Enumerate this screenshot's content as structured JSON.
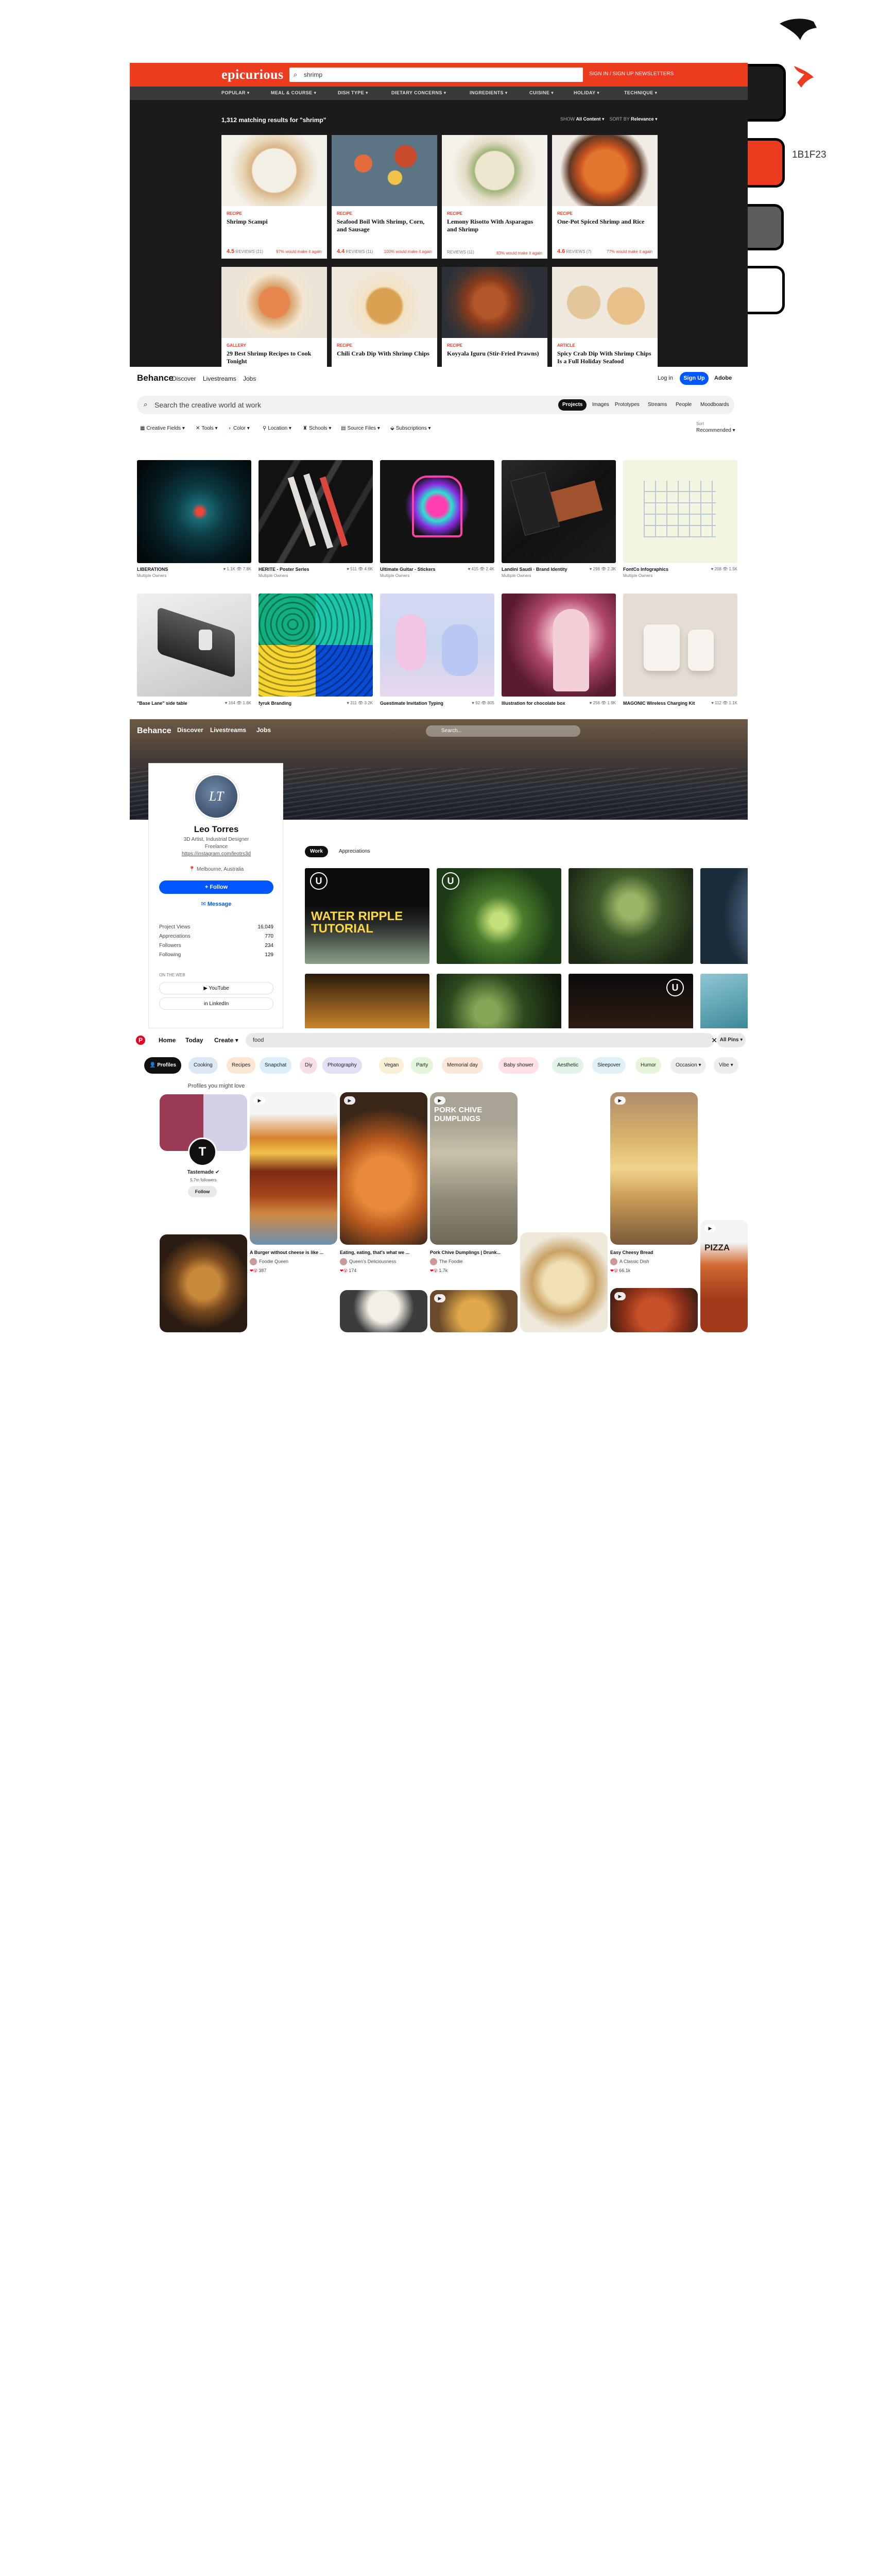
{
  "palette": {
    "swatches": [
      {
        "color": "#1b1b1b"
      },
      {
        "color": "#ec3b1f"
      },
      {
        "color": "#5c5c5c"
      },
      {
        "color": "#ffffff"
      }
    ],
    "code_label": "1B1F23"
  },
  "epicurious": {
    "logo": "epicurious",
    "search_value": "shrimp",
    "account_links": "SIGN IN / SIGN UP    NEWSLETTERS",
    "nav": [
      "POPULAR ▾",
      "MEAL & COURSE ▾",
      "DISH TYPE ▾",
      "DIETARY CONCERNS ▾",
      "INGREDIENTS ▾",
      "CUISINE ▾",
      "HOLIDAY ▾",
      "TECHNIQUE ▾"
    ],
    "result_count": "1,312 matching results for \"shrimp\"",
    "show_label": "SHOW",
    "show_value": "All Content ▾",
    "sort_label": "SORT BY",
    "sort_value": "Relevance ▾",
    "cards": [
      {
        "tag": "RECIPE",
        "title": "Shrimp Scampi",
        "rating": "4.5",
        "reviews": "97% would make it again",
        "count": "REVIEWS (21)"
      },
      {
        "tag": "RECIPE",
        "title": "Seafood Boil With Shrimp, Corn, and Sausage",
        "rating": "4.4",
        "reviews": "REVIEWS (11)",
        "count": "100% would make it again"
      },
      {
        "tag": "RECIPE",
        "title": "Lemony Risotto With Asparagus and Shrimp",
        "rating": "",
        "reviews": "REVIEWS (11)",
        "count": "83% would make it again"
      },
      {
        "tag": "RECIPE",
        "title": "One-Pot Spiced Shrimp and Rice",
        "rating": "4.6",
        "reviews": "REVIEWS (7)",
        "count": "77% would make it again"
      },
      {
        "tag": "GALLERY",
        "title": "29 Best Shrimp Recipes to Cook Tonight",
        "rating": "",
        "reviews": "",
        "count": ""
      },
      {
        "tag": "RECIPE",
        "title": "Chili Crab Dip With Shrimp Chips",
        "rating": "",
        "reviews": "",
        "count": ""
      },
      {
        "tag": "RECIPE",
        "title": "Koyyala Iguru (Stir-Fried Prawns)",
        "rating": "",
        "reviews": "",
        "count": ""
      },
      {
        "tag": "ARTICLE",
        "title": "Spicy Crab Dip With Shrimp Chips Is a Full Holiday Seafood",
        "rating": "",
        "reviews": "",
        "count": ""
      }
    ]
  },
  "behance": {
    "brand": "Behance",
    "nav": [
      "Discover",
      "Livestreams",
      "Jobs"
    ],
    "login": "Log in",
    "signup": "Sign Up",
    "adobe": "Adobe",
    "search_placeholder": "Search the creative world at work",
    "segments": [
      "Projects",
      "Images",
      "Prototypes",
      "Streams",
      "People",
      "Moodboards"
    ],
    "filters": [
      "Creative Fields ▾",
      "Tools ▾",
      "Color ▾",
      "Location ▾",
      "Schools ▾",
      "Source Files ▾",
      "Subscriptions ▾"
    ],
    "sort_label": "Sort",
    "sort_value": "Recommended ▾",
    "tiles": [
      {
        "title": "LIBERATIONS",
        "owner": "Multiple Owners",
        "stats": "♥ 1.1K  👁 7.8K"
      },
      {
        "title": "HERITE - Poster Series",
        "owner": "Multiple Owners",
        "stats": "♥ 511  👁 4.6K"
      },
      {
        "title": "Ultimate Guitar - Stickers",
        "owner": "Multiple Owners",
        "stats": "♥ 415  👁 2.4K"
      },
      {
        "title": "Landini Saudi · Brand Identity",
        "owner": "Multiple Owners",
        "stats": "♥ 298  👁 2.3K"
      },
      {
        "title": "FontCo Infographics",
        "owner": "Multiple Owners",
        "stats": "♥ 208  👁 1.5K"
      },
      {
        "title": "\"Base Lane\" side table",
        "owner": "",
        "stats": "♥ 164  👁 1.6K"
      },
      {
        "title": "fyruk Branding",
        "owner": "",
        "stats": "♥ 311  👁 3.2K"
      },
      {
        "title": "Guestimate Invitation Typing",
        "owner": "",
        "stats": "♥ 92  👁 805"
      },
      {
        "title": "Illustration for chocolate box",
        "owner": "",
        "stats": "♥ 256  👁 1.9K"
      },
      {
        "title": "MAGONIC Wireless Charging Kit",
        "owner": "",
        "stats": "♥ 112  👁 1.1K"
      }
    ]
  },
  "profile": {
    "brand": "Behance",
    "nav": [
      "Discover",
      "Livestreams",
      "Jobs"
    ],
    "search_placeholder": "Search...",
    "avatar_initials": "LT",
    "name": "Leo Torres",
    "role": "3D Artist, Industrial Designer",
    "freelance": "Freelance",
    "link": "https://instagram.com/leotrs3d",
    "location": "📍 Melbourne, Australia",
    "follow": "+ Follow",
    "message": "✉ Message",
    "stats": [
      {
        "label": "Project Views",
        "value": "16,049"
      },
      {
        "label": "Appreciations",
        "value": "770"
      },
      {
        "label": "Followers",
        "value": "234"
      },
      {
        "label": "Following",
        "value": "129"
      }
    ],
    "on_the_web": "ON THE WEB",
    "socials": [
      "▶ YouTube",
      "in LinkedIn"
    ],
    "tabs": [
      "Work",
      "Appreciations"
    ],
    "work_title": "WATER RIPPLE TUTORIAL"
  },
  "pinterest": {
    "nav": [
      "Home",
      "Today",
      "Create ▾"
    ],
    "search_value": "food",
    "all_pins": "All Pins ▾",
    "chips": [
      "👤 Profiles",
      "Cooking",
      "Recipes",
      "Snapchat",
      "Diy",
      "Photography",
      "Vegan",
      "Party",
      "Memorial day",
      "Baby shower",
      "Aesthetic",
      "Sleepover",
      "Humor",
      "Occasion ▾",
      "Vibe ▾"
    ],
    "profiles_title": "Profiles you might love",
    "profile_name": "Tastemade ✔",
    "profile_followers": "5.7m followers",
    "profile_follow": "Follow",
    "pins": [
      {
        "title": "A Burger without cheese is like ...",
        "by": "Foodie Queen",
        "rx": "387"
      },
      {
        "title": "Eating, eating, that's what we ...",
        "by": "Queen's Deliciousness",
        "rx": "174"
      },
      {
        "title": "Pork Chive Dumplings | Drunk...",
        "by": "The Foodie",
        "rx": "1.7k"
      },
      {
        "title": "Easy Cheesy Bread",
        "by": "A Classic Dish",
        "rx": "66.1k"
      }
    ],
    "dumpling_overlay": "PORK CHIVE DUMPLINGS",
    "pizza_overlay": "PIZZA"
  }
}
